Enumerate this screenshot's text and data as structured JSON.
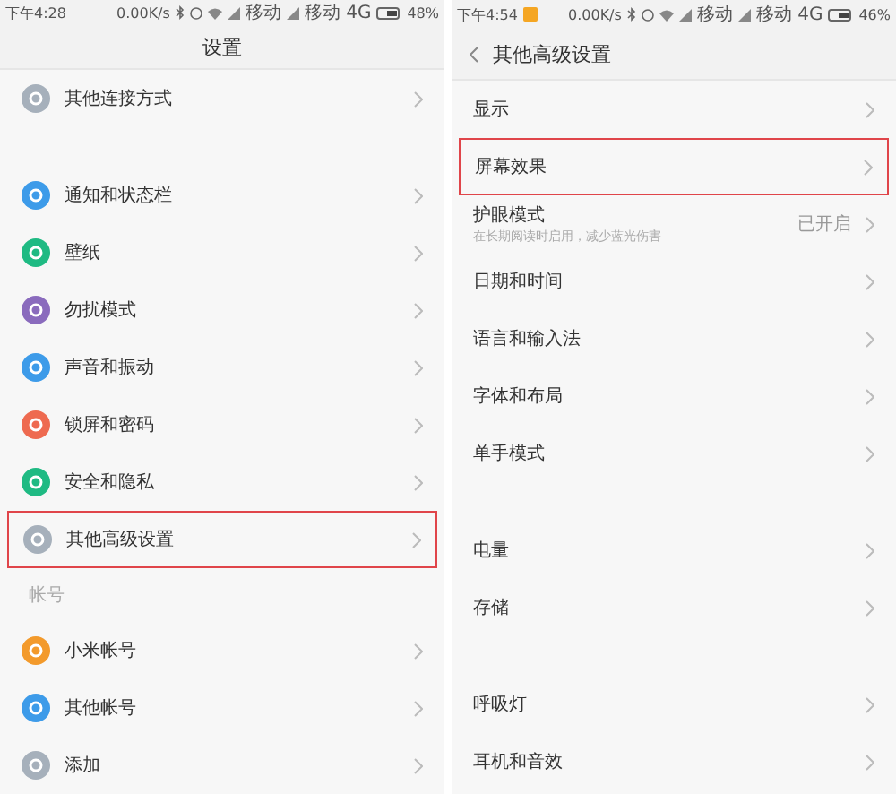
{
  "screens": [
    {
      "status_bar": {
        "time": "下午4:28",
        "speed": "0.00K/s",
        "carrier_1": "移动",
        "carrier_2": "移动 4G",
        "battery": "48%",
        "notification": false
      },
      "header": {
        "title": "设置",
        "back": false
      },
      "items": [
        {
          "kind": "row",
          "label": "其他连接方式",
          "color": "#a6b0bb",
          "highlighted": false
        },
        {
          "kind": "spacer"
        },
        {
          "kind": "row",
          "label": "通知和状态栏",
          "color": "#3d9be9",
          "highlighted": false
        },
        {
          "kind": "row",
          "label": "壁纸",
          "color": "#1fba83",
          "highlighted": false
        },
        {
          "kind": "row",
          "label": "勿扰模式",
          "color": "#8a6bbd",
          "highlighted": false
        },
        {
          "kind": "row",
          "label": "声音和振动",
          "color": "#3d9be9",
          "highlighted": false
        },
        {
          "kind": "row",
          "label": "锁屏和密码",
          "color": "#ee6a50",
          "highlighted": false
        },
        {
          "kind": "row",
          "label": "安全和隐私",
          "color": "#1fba83",
          "highlighted": false
        },
        {
          "kind": "row",
          "label": "其他高级设置",
          "color": "#a6b0bb",
          "highlighted": true
        },
        {
          "kind": "section",
          "label": "帐号"
        },
        {
          "kind": "row",
          "label": "小米帐号",
          "color": "#f39a2b",
          "highlighted": false
        },
        {
          "kind": "row",
          "label": "其他帐号",
          "color": "#3d9be9",
          "highlighted": false
        },
        {
          "kind": "row",
          "label": "添加",
          "color": "#a6b0bb",
          "highlighted": false
        }
      ]
    },
    {
      "status_bar": {
        "time": "下午4:54",
        "speed": "0.00K/s",
        "carrier_1": "移动",
        "carrier_2": "移动 4G",
        "battery": "46%",
        "notification": true
      },
      "header": {
        "title": "其他高级设置",
        "back": true
      },
      "items": [
        {
          "kind": "row",
          "label": "显示",
          "highlighted": false
        },
        {
          "kind": "row",
          "label": "屏幕效果",
          "highlighted": true
        },
        {
          "kind": "row",
          "label": "护眼模式",
          "subtitle": "在长期阅读时启用，减少蓝光伤害",
          "value": "已开启",
          "highlighted": false
        },
        {
          "kind": "row",
          "label": "日期和时间",
          "highlighted": false
        },
        {
          "kind": "row",
          "label": "语言和输入法",
          "highlighted": false
        },
        {
          "kind": "row",
          "label": "字体和布局",
          "highlighted": false
        },
        {
          "kind": "row",
          "label": "单手模式",
          "highlighted": false
        },
        {
          "kind": "spacer"
        },
        {
          "kind": "row",
          "label": "电量",
          "highlighted": false
        },
        {
          "kind": "row",
          "label": "存储",
          "highlighted": false
        },
        {
          "kind": "spacer"
        },
        {
          "kind": "row",
          "label": "呼吸灯",
          "highlighted": false
        },
        {
          "kind": "row",
          "label": "耳机和音效",
          "highlighted": false
        }
      ]
    }
  ]
}
